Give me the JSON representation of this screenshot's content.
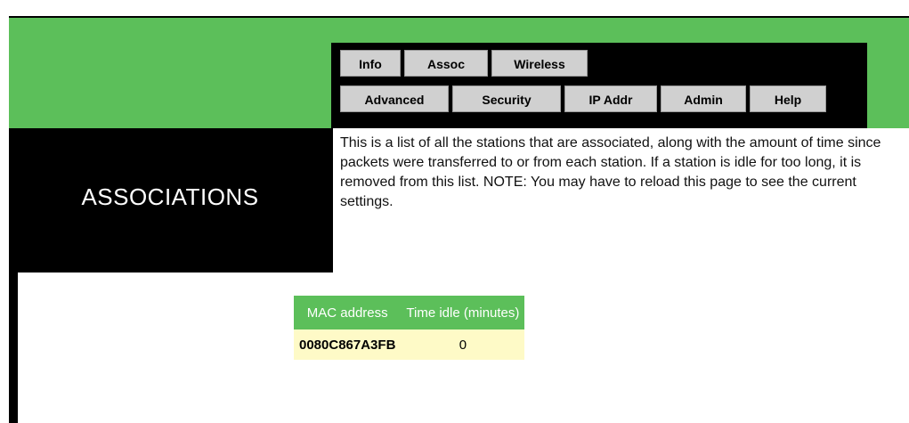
{
  "tabs_row1": [
    "Info",
    "Assoc",
    "Wireless"
  ],
  "tabs_row2": [
    "Advanced",
    "Security",
    "IP Addr",
    "Admin",
    "Help"
  ],
  "page_title": "ASSOCIATIONS",
  "description": "This is a list of all the stations that are associated, along with the amount of time since packets were transferred to or from each station. If a station is idle for too long, it is removed from this list. NOTE: You may have to reload this page to see the current settings.",
  "table": {
    "headers": [
      "MAC address",
      "Time idle (minutes)"
    ],
    "rows": [
      {
        "mac": "0080C867A3FB",
        "idle": "0"
      }
    ]
  },
  "colors": {
    "accent_green": "#5cbf5a",
    "row_bg": "#fefac7"
  }
}
